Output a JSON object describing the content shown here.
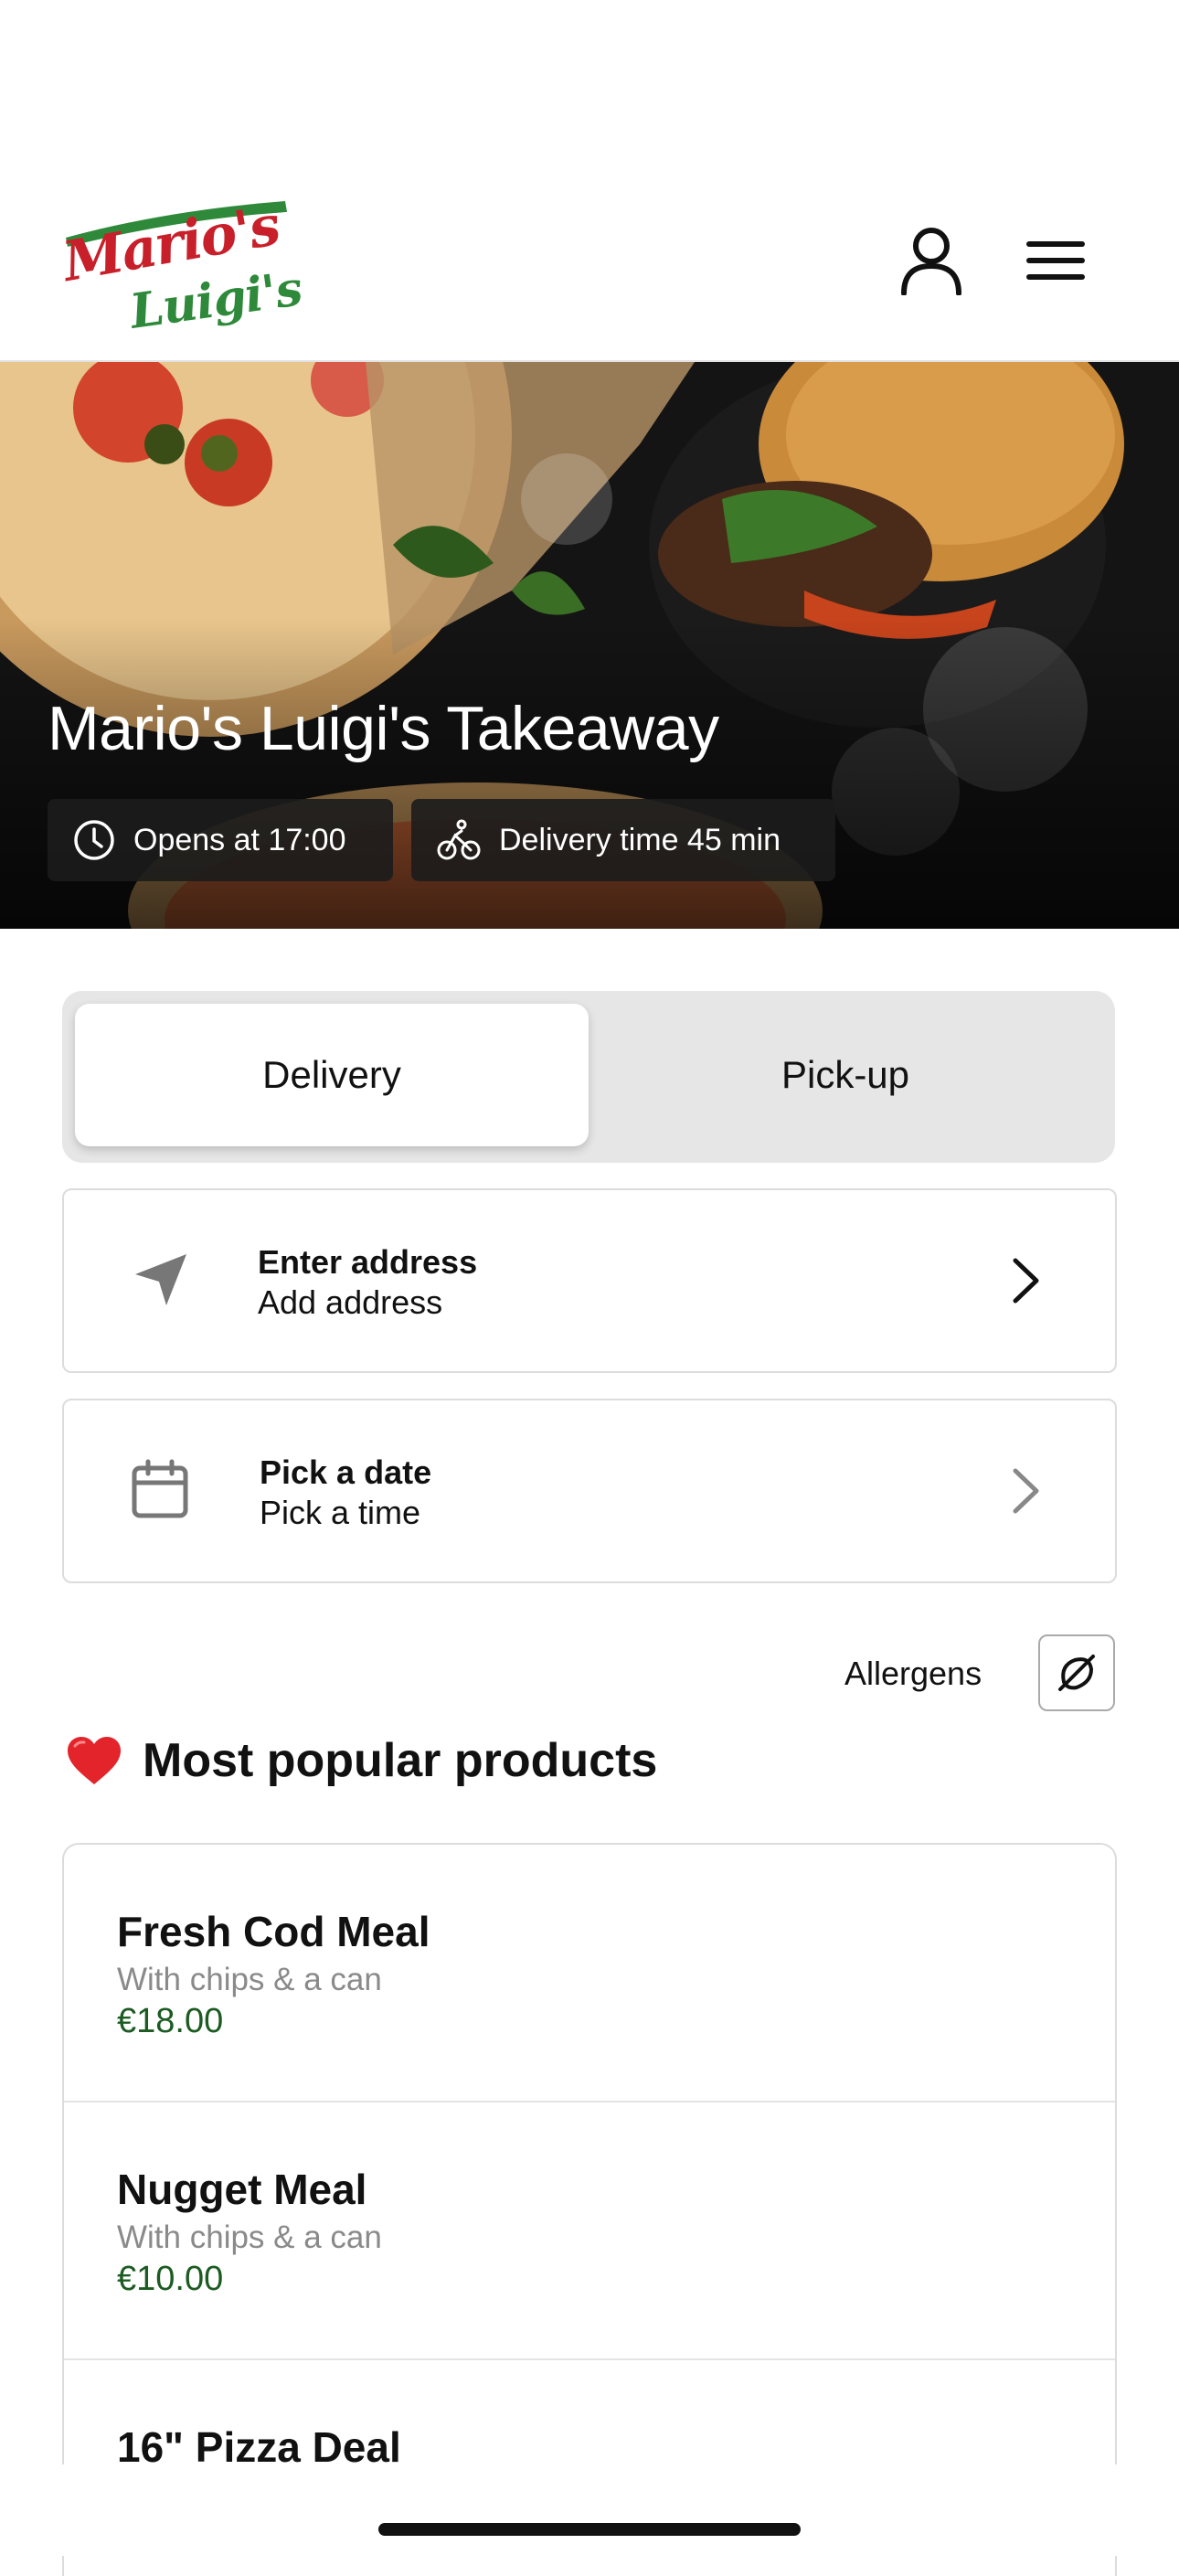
{
  "header": {
    "logo_line1": "Mario's",
    "logo_line2": "Luigi's",
    "account_icon": "person-icon",
    "menu_icon": "hamburger-menu-icon"
  },
  "hero": {
    "title": "Mario's Luigi's Takeaway",
    "opens_label": "Opens at 17:00",
    "delivery_label": "Delivery time 45 min",
    "opens_icon": "clock-icon",
    "delivery_icon": "bicycle-icon"
  },
  "order_mode": {
    "options": [
      "Delivery",
      "Pick-up"
    ],
    "selected": "Delivery"
  },
  "address": {
    "title": "Enter address",
    "subtitle": "Add address",
    "icon": "location-arrow-icon"
  },
  "schedule": {
    "title": "Pick a date",
    "subtitle": "Pick a time",
    "icon": "calendar-icon"
  },
  "allergens": {
    "label": "Allergens",
    "icon": "no-allergen-icon"
  },
  "popular": {
    "title": "Most popular products",
    "icon": "heart-icon",
    "products": [
      {
        "name": "Fresh Cod Meal",
        "desc": "With chips & a can",
        "price": "€18.00"
      },
      {
        "name": "Nugget Meal",
        "desc": "With chips & a can",
        "price": "€10.00"
      },
      {
        "name": "16\" Pizza Deal",
        "desc": "",
        "price": ""
      }
    ]
  },
  "colors": {
    "price_green": "#1c5b22",
    "logo_red": "#c8202a",
    "logo_green": "#2e8a3a"
  }
}
